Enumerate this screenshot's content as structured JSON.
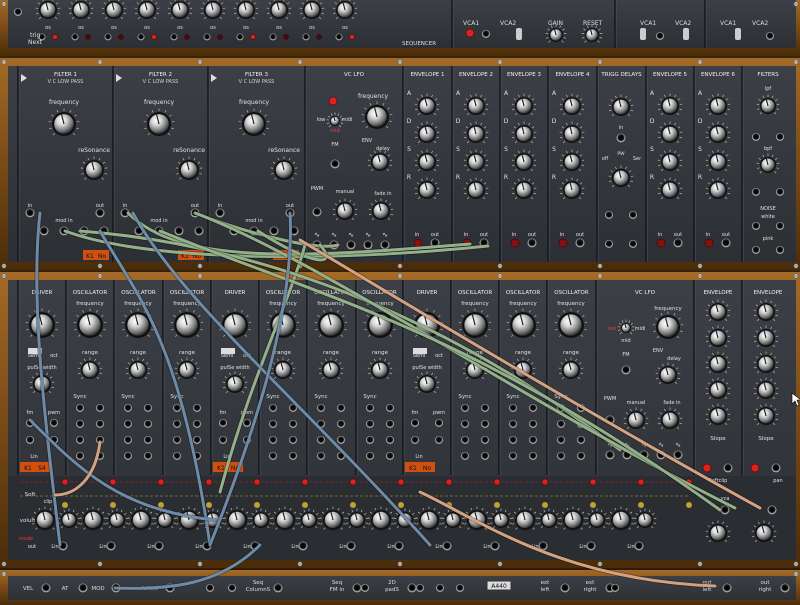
{
  "top_row": {
    "trig_label": "trig",
    "next_label": "Next",
    "os_label": "os",
    "sequencer_label": "SEQUENCER",
    "vca1_label": "VCA1",
    "vca2_label": "VCA2",
    "gain_label": "GAIN",
    "reset_label": "RESET"
  },
  "middle_row": {
    "modules": [
      {
        "title": "FILTER 1",
        "sub": "V C LOW PASS"
      },
      {
        "title": "FILTER 2",
        "sub": "V C LOW PASS"
      },
      {
        "title": "FILTER 3",
        "sub": "V C LOW PASS"
      },
      {
        "title": "VC LFO",
        "sub": ""
      },
      {
        "title": "ENVELOPE 1",
        "sub": ""
      },
      {
        "title": "ENVELOPE 2",
        "sub": ""
      },
      {
        "title": "ENVELOPE 3",
        "sub": ""
      },
      {
        "title": "ENVELOPE 4",
        "sub": ""
      },
      {
        "title": "TRIGG DELAYS",
        "sub": ""
      },
      {
        "title": "ENVELOPE 5",
        "sub": ""
      },
      {
        "title": "ENVELOPE 6",
        "sub": ""
      },
      {
        "title": "FILTERS",
        "sub": ""
      }
    ],
    "filter_labels": {
      "frequency": "frequency",
      "resonance": "reSonance",
      "in": "in",
      "out": "out",
      "mod_in": "mod in",
      "k1": "K1",
      "no": "No"
    },
    "lfo_labels": {
      "frequency": "frequency",
      "low": "low",
      "midi": "midi",
      "mid": "mid",
      "fm": "FM",
      "in": "in",
      "env": "ENV",
      "delay": "delay",
      "fade_in": "fade in",
      "pwm": "PWM",
      "manual": "manual"
    },
    "adsr": [
      "A",
      "D",
      "S",
      "R"
    ],
    "trigg_labels": {
      "in": "in",
      "off": "off",
      "pw": "PW",
      "ser": "Ser",
      "out": "out"
    },
    "filters_labels": {
      "lpf": "lpf",
      "bpf": "bpf",
      "noise": "NOISE",
      "white": "white",
      "pink": "pink",
      "in": "in",
      "out": "out"
    }
  },
  "bottom_row": {
    "modules": [
      "DRIVER",
      "OSCILLATOR",
      "OSCILLATOR",
      "OSCILLATOR",
      "DRIVER",
      "OSCILLATOR",
      "OSCILLATOR",
      "OSCILLATOR",
      "DRIVER",
      "OSCILLATOR",
      "OSCILLATOR",
      "OSCILLATOR",
      "VC LFO",
      "ENVELOPE",
      "ENVELOPE"
    ],
    "osc_labels": {
      "frequency": "frequency",
      "range": "range",
      "sync": "Sync",
      "lin": "Lin",
      "fm": "fm",
      "pwm": "pwm",
      "pulse_width": "pulSe width",
      "semi": "Semi",
      "oct": "oct"
    },
    "misc_labels": {
      "soft": "Soft",
      "in": "in",
      "clip": "clip",
      "volume": "volume",
      "out": "out",
      "mode": "mode",
      "k1": "K1",
      "s4": "S4",
      "no": "No",
      "slope": "Slope",
      "softclip": "Softclip",
      "pan": "pan",
      "vca": "vca",
      "in_out": "in   out"
    }
  },
  "keyboard_bar": {
    "labels": [
      "VEL",
      "AT",
      "MOD",
      "follow",
      "Seq\nColumnS",
      "Seq\nFM in",
      "2D\npadS",
      "ext\nleft",
      "ext\nright",
      "out\nleft",
      "out\nright"
    ],
    "display": "A440"
  },
  "colors": {
    "wood": "#7a4a16",
    "panel": "#33363c",
    "cable_green": "#94b08a",
    "cable_blue": "#6f8aa6",
    "cable_peach": "#d2a282",
    "led_red": "#e02020"
  }
}
